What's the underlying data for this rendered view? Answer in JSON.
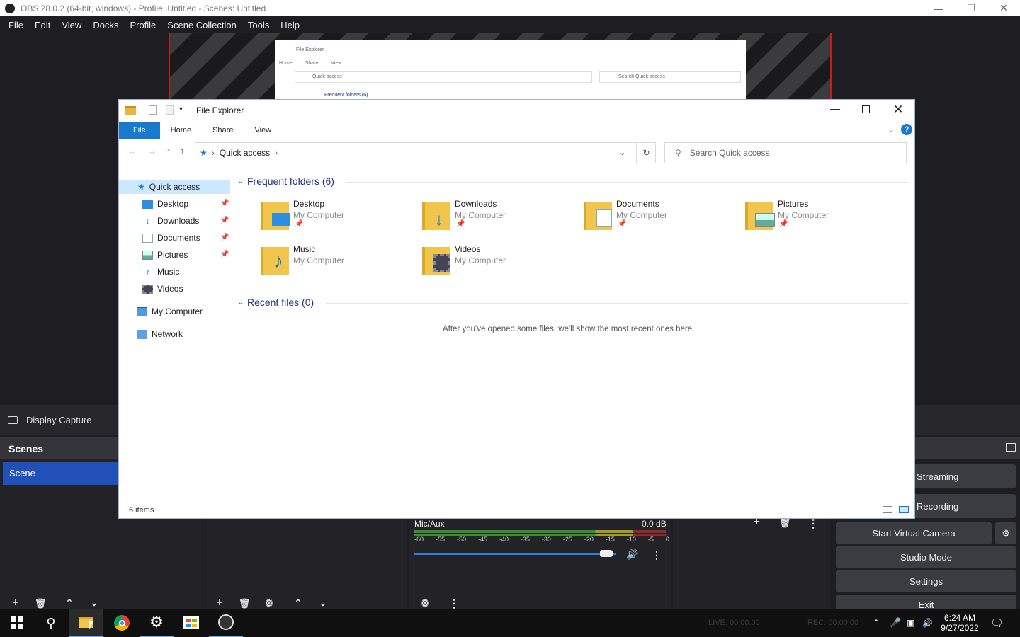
{
  "obs": {
    "title": "OBS 28.0.2 (64-bit, windows) - Profile: Untitled - Scenes: Untitled",
    "menu": [
      "File",
      "Edit",
      "View",
      "Docks",
      "Profile",
      "Scene Collection",
      "Tools",
      "Help"
    ],
    "source_name": "Display Capture",
    "scenes_header": "Scenes",
    "scene_item": "Scene",
    "mixer": {
      "channel": "Mic/Aux",
      "level": "0.0 dB",
      "ticks": [
        "-60",
        "-55",
        "-50",
        "-45",
        "-40",
        "-35",
        "-30",
        "-25",
        "-20",
        "-15",
        "-10",
        "-5",
        "0"
      ],
      "volume": 0.95
    },
    "controls": {
      "streaming": "Streaming",
      "recording": "Recording",
      "virtual_camera": "Start Virtual Camera",
      "studio": "Studio Mode",
      "settings": "Settings",
      "exit": "Exit"
    }
  },
  "mini": {
    "title": "File Explorer",
    "tabs": [
      "Home",
      "Share",
      "View"
    ],
    "addr": "Quick access",
    "search": "Search Quick access",
    "group": "Frequent folders (6)",
    "top_text": "Frequent folders (6)"
  },
  "explorer": {
    "title": "File Explorer",
    "ribbon": [
      "File",
      "Home",
      "Share",
      "View"
    ],
    "address": "Quick access",
    "search_placeholder": "Search Quick access",
    "nav": {
      "quick": "Quick access",
      "items": [
        "Desktop",
        "Downloads",
        "Documents",
        "Pictures",
        "Music",
        "Videos"
      ],
      "computer": "My Computer",
      "network": "Network"
    },
    "frequent_header": "Frequent folders (6)",
    "folders": [
      {
        "name": "Desktop",
        "sub": "My Computer"
      },
      {
        "name": "Downloads",
        "sub": "My Computer"
      },
      {
        "name": "Documents",
        "sub": "My Computer"
      },
      {
        "name": "Pictures",
        "sub": "My Computer"
      },
      {
        "name": "Music",
        "sub": "My Computer"
      },
      {
        "name": "Videos",
        "sub": "My Computer"
      }
    ],
    "recent_header": "Recent files (0)",
    "empty_text": "After you've opened some files, we'll show the most recent ones here.",
    "status": "6 items"
  },
  "taskbar": {
    "time": "6:24 AM",
    "date": "9/27/2022",
    "live": "LIVE: 00:00:00",
    "rec": "REC: 00:00:00"
  }
}
